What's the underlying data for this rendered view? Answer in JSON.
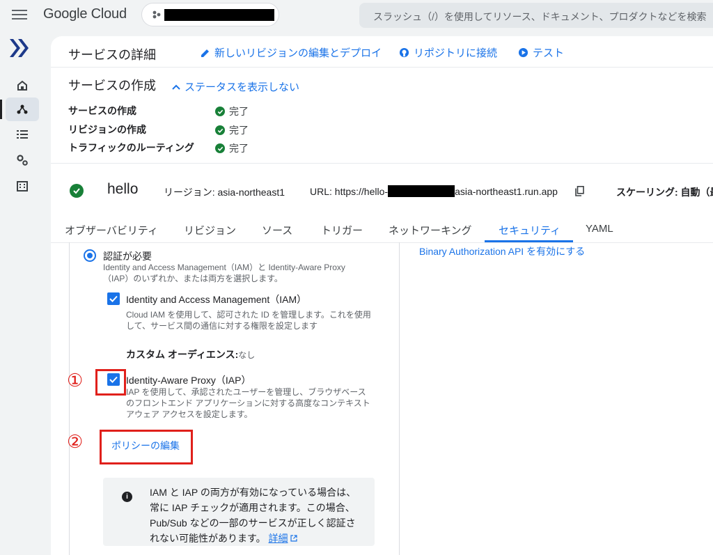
{
  "topbar": {
    "product": "Google Cloud",
    "search_placeholder": "スラッシュ（/）を使用してリソース、ドキュメント、プロダクトなどを検索"
  },
  "rail": {
    "items": [
      "home-icon",
      "services-icon",
      "list-icon",
      "settings-icon",
      "building-icon"
    ]
  },
  "header": {
    "title": "サービスの詳細",
    "actions": [
      {
        "label": "新しいリビジョンの編集とデプロイ",
        "icon": "pencil-icon"
      },
      {
        "label": "リポジトリに接続",
        "icon": "github-icon"
      },
      {
        "label": "テスト",
        "icon": "play-icon"
      }
    ]
  },
  "creation": {
    "title": "サービスの作成",
    "toggle_label": "ステータスを表示しない",
    "steps": [
      {
        "label": "サービスの作成",
        "status": "完了"
      },
      {
        "label": "リビジョンの作成",
        "status": "完了"
      },
      {
        "label": "トラフィックのルーティング",
        "status": "完了"
      }
    ]
  },
  "service": {
    "name": "hello",
    "region": "リージョン: asia-northeast1",
    "url_prefix": "URL: https://hello-",
    "url_suffix": "asia-northeast1.run.app",
    "scaling": "スケーリング: 自動（最"
  },
  "tabs": [
    "オブザーバビリティ",
    "リビジョン",
    "ソース",
    "トリガー",
    "ネットワーキング",
    "セキュリティ",
    "YAML"
  ],
  "active_tab": "セキュリティ",
  "security": {
    "auth_required_label": "認証が必要",
    "auth_required_desc_1": "Identity and Access Management（IAM）と Identity-Aware Proxy",
    "auth_required_desc_2": "（IAP）のいずれか、または両方を選択します。",
    "iam_label": "Identity and Access Management（IAM）",
    "iam_desc_1": "Cloud IAM を使用して、認可された ID を管理します。これを使用",
    "iam_desc_2": "して、サービス間の通信に対する権限を設定します",
    "audience_label": "カスタム オーディエンス:",
    "audience_value": "なし",
    "iap_label": "Identity-Aware Proxy（IAP）",
    "iap_desc_1": "IAP を使用して、承認されたユーザーを管理し、ブラウザベース",
    "iap_desc_2": "のフロントエンド アプリケーションに対する高度なコンテキスト",
    "iap_desc_3": "アウェア アクセスを設定します。",
    "edit_policy": "ポリシーの編集",
    "info_1": "IAM と IAP の両方が有効になっている場合は、",
    "info_2": "常に IAP チェックが適用されます。この場合、",
    "info_3": "Pub/Sub などの一部のサービスが正しく認証さ",
    "info_4": "れない可能性があります。",
    "info_link": "詳細",
    "binary_auth": "Binary Authorization API を有効にする"
  },
  "annotations": [
    "①",
    "②"
  ],
  "colors": {
    "accent": "#1a73e8",
    "success": "#188038",
    "annotation": "#e0201b"
  }
}
